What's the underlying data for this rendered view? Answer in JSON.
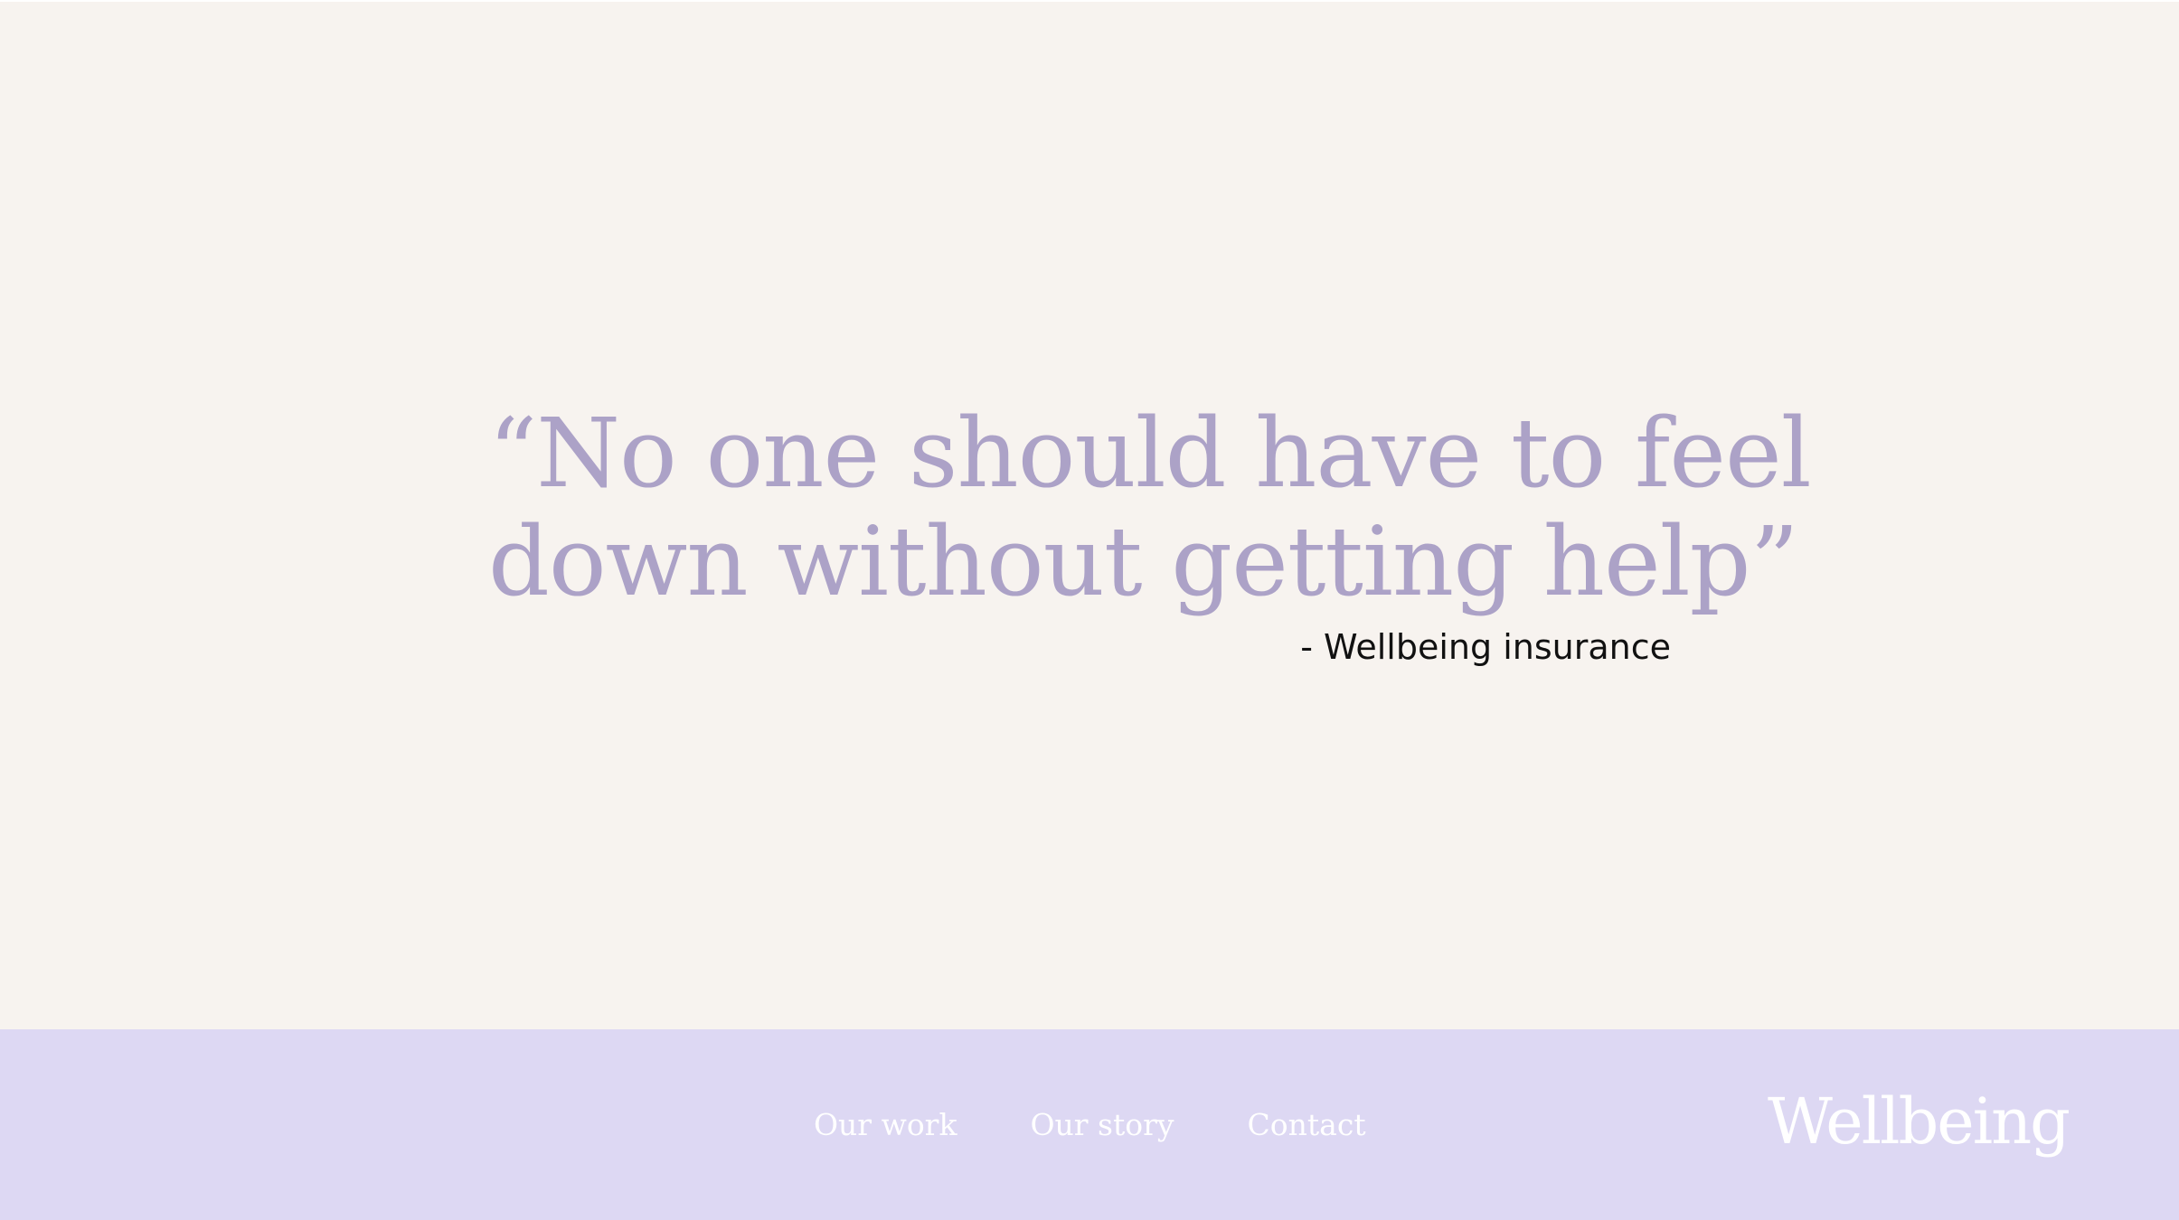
{
  "hero": {
    "quote_line1": "“No one should have to feel",
    "quote_line2": "down without getting help”",
    "attribution": "- Wellbeing insurance"
  },
  "footer": {
    "nav": [
      {
        "label": "Our work"
      },
      {
        "label": "Our story"
      },
      {
        "label": "Contact"
      }
    ],
    "brand": "Wellbeing"
  },
  "colors": {
    "background": "#f7f3ef",
    "quote_text": "#aca2c7",
    "footer_bg": "#ddd8f3",
    "footer_text": "#ffffff",
    "attribution_text": "#111111"
  }
}
